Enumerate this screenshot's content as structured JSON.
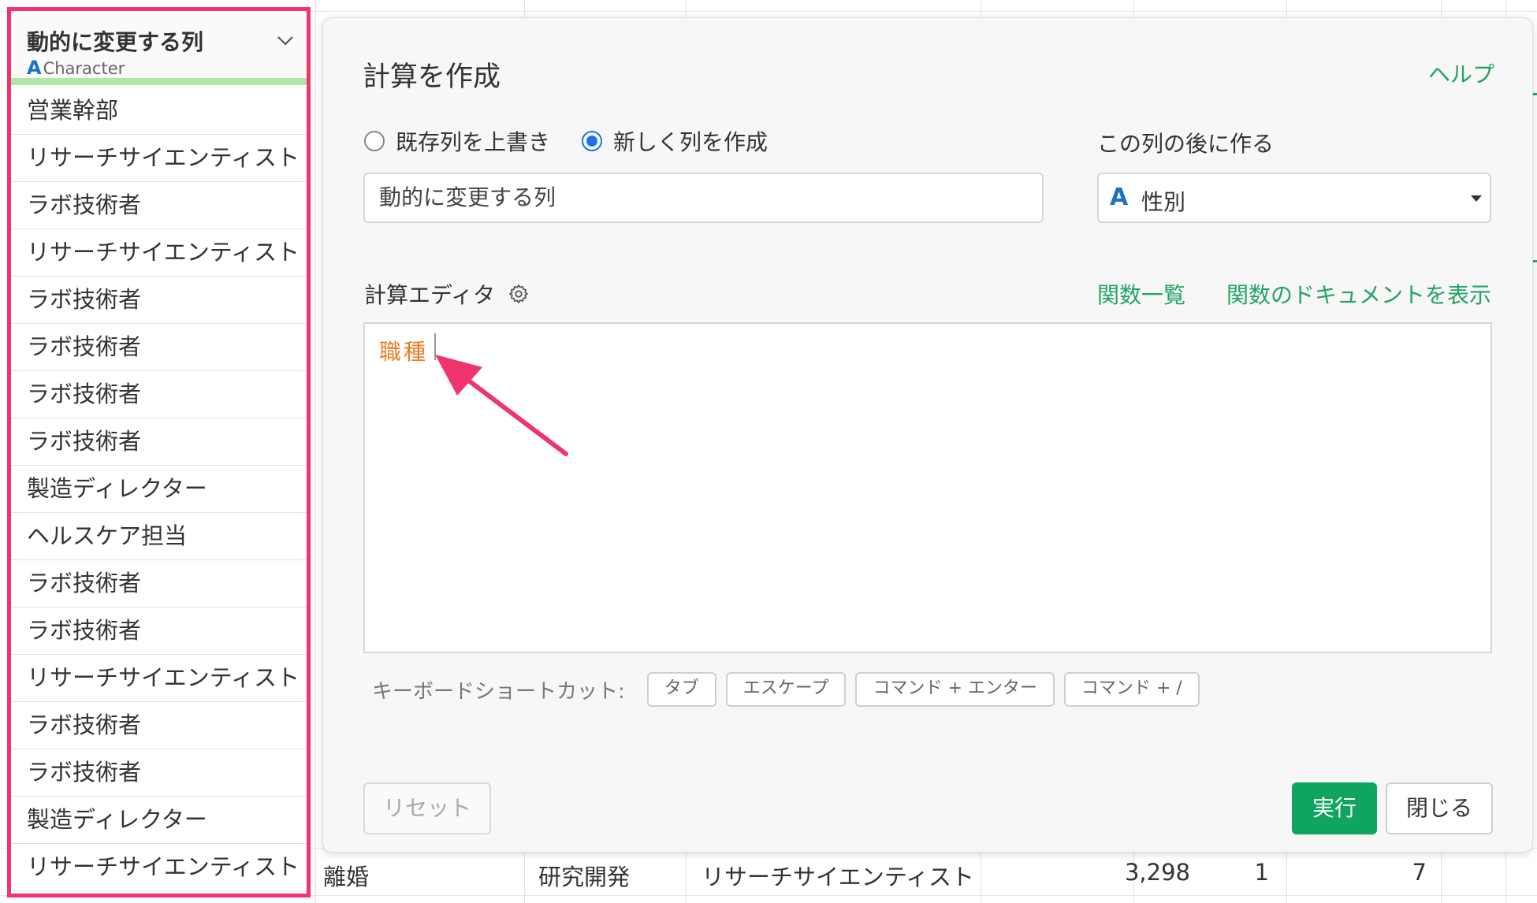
{
  "column": {
    "title": "動的に変更する列",
    "type_icon": "A",
    "type_label": "Character",
    "cells": [
      "営業幹部",
      "リサーチサイエンティスト",
      "ラボ技術者",
      "リサーチサイエンティスト",
      "ラボ技術者",
      "ラボ技術者",
      "ラボ技術者",
      "ラボ技術者",
      "製造ディレクター",
      "ヘルスケア担当",
      "ラボ技術者",
      "ラボ技術者",
      "リサーチサイエンティスト",
      "ラボ技術者",
      "ラボ技術者",
      "製造ディレクター",
      "リサーチサイエンティスト"
    ]
  },
  "background_row": {
    "c1": "離婚",
    "c2": "研究開発",
    "c3": "リサーチサイエンティスト",
    "c4": "3,298",
    "c5": "1",
    "c6": "7"
  },
  "dialog": {
    "title": "計算を作成",
    "help": "ヘルプ",
    "radio_overwrite": "既存列を上書き",
    "radio_new": "新しく列を作成",
    "after_label": "この列の後に作る",
    "name_value": "動的に変更する列",
    "after_icon": "A",
    "after_value": "性別",
    "editor_label": "計算エディタ",
    "fn_list": "関数一覧",
    "fn_docs": "関数のドキュメントを表示",
    "editor_code": "職種",
    "shortcuts_label": "キーボードショートカット:",
    "shortcuts": [
      "タブ",
      "エスケープ",
      "コマンド + エンター",
      "コマンド + /"
    ],
    "reset": "リセット",
    "run": "実行",
    "close": "閉じる"
  },
  "colors": {
    "highlight": "#f0346d",
    "accent_green": "#21a463",
    "run_button": "#0fa560",
    "code_orange": "#e67e22",
    "type_blue": "#1a73c8"
  }
}
